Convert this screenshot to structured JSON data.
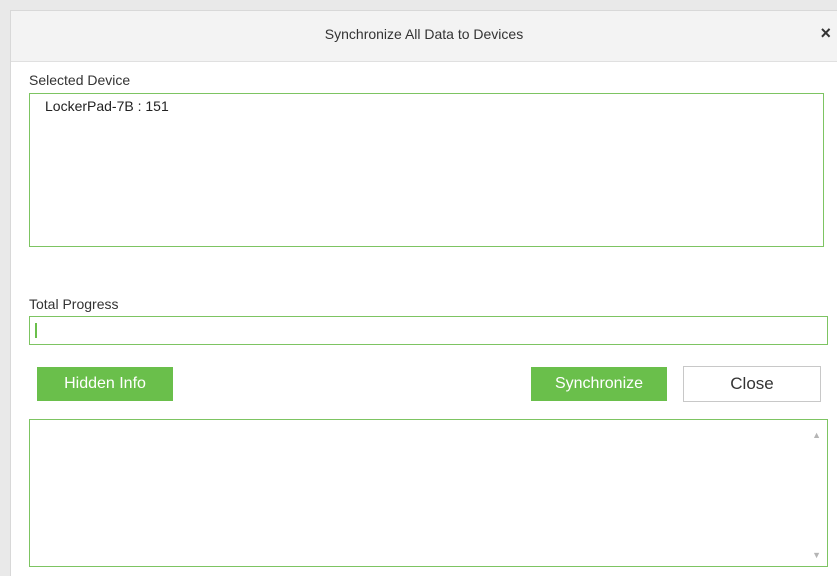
{
  "dialog": {
    "title": "Synchronize All Data to Devices",
    "close_symbol": "×"
  },
  "selected_device": {
    "label": "Selected Device",
    "items": [
      "LockerPad-7B : 151"
    ]
  },
  "progress": {
    "label": "Total Progress",
    "value_percent": 0
  },
  "buttons": {
    "hidden_info": "Hidden Info",
    "synchronize": "Synchronize",
    "close": "Close"
  },
  "log": {
    "scroll_up_icon": "▲",
    "scroll_down_icon": "▼"
  },
  "colors": {
    "accent": "#6abf4b",
    "border": "#7dc462"
  }
}
